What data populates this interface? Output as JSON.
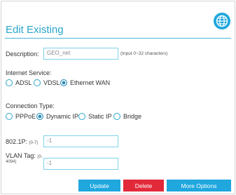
{
  "header": {
    "title": "Edit Existing",
    "globe_icon": "globe-icon"
  },
  "description": {
    "label": "Description:",
    "value": "GEO_net",
    "hint": "(Input 0~32 characters)"
  },
  "internet_service": {
    "label": "Internet Service:",
    "options": [
      "ADSL",
      "VDSL",
      "Ethernet WAN"
    ],
    "selected": "Ethernet WAN"
  },
  "connection_type": {
    "label": "Connection Type:",
    "options": [
      "PPPoE",
      "Dynamic IP",
      "Static IP",
      "Bridge"
    ],
    "selected": "Dynamic IP"
  },
  "p8021": {
    "label": "802.1P:",
    "range": "(0-7)",
    "value": "-1"
  },
  "vlan": {
    "label": "VLAN Tag:",
    "range": "(0-4094)",
    "range_line1": "(0-",
    "range_line2": "4094)",
    "value": "-1"
  },
  "buttons": {
    "update": "Update",
    "delete": "Delete",
    "more": "More Options"
  },
  "colors": {
    "accent": "#2aa6c9",
    "button_blue": "#1fa7de",
    "button_red": "#e2293a"
  }
}
